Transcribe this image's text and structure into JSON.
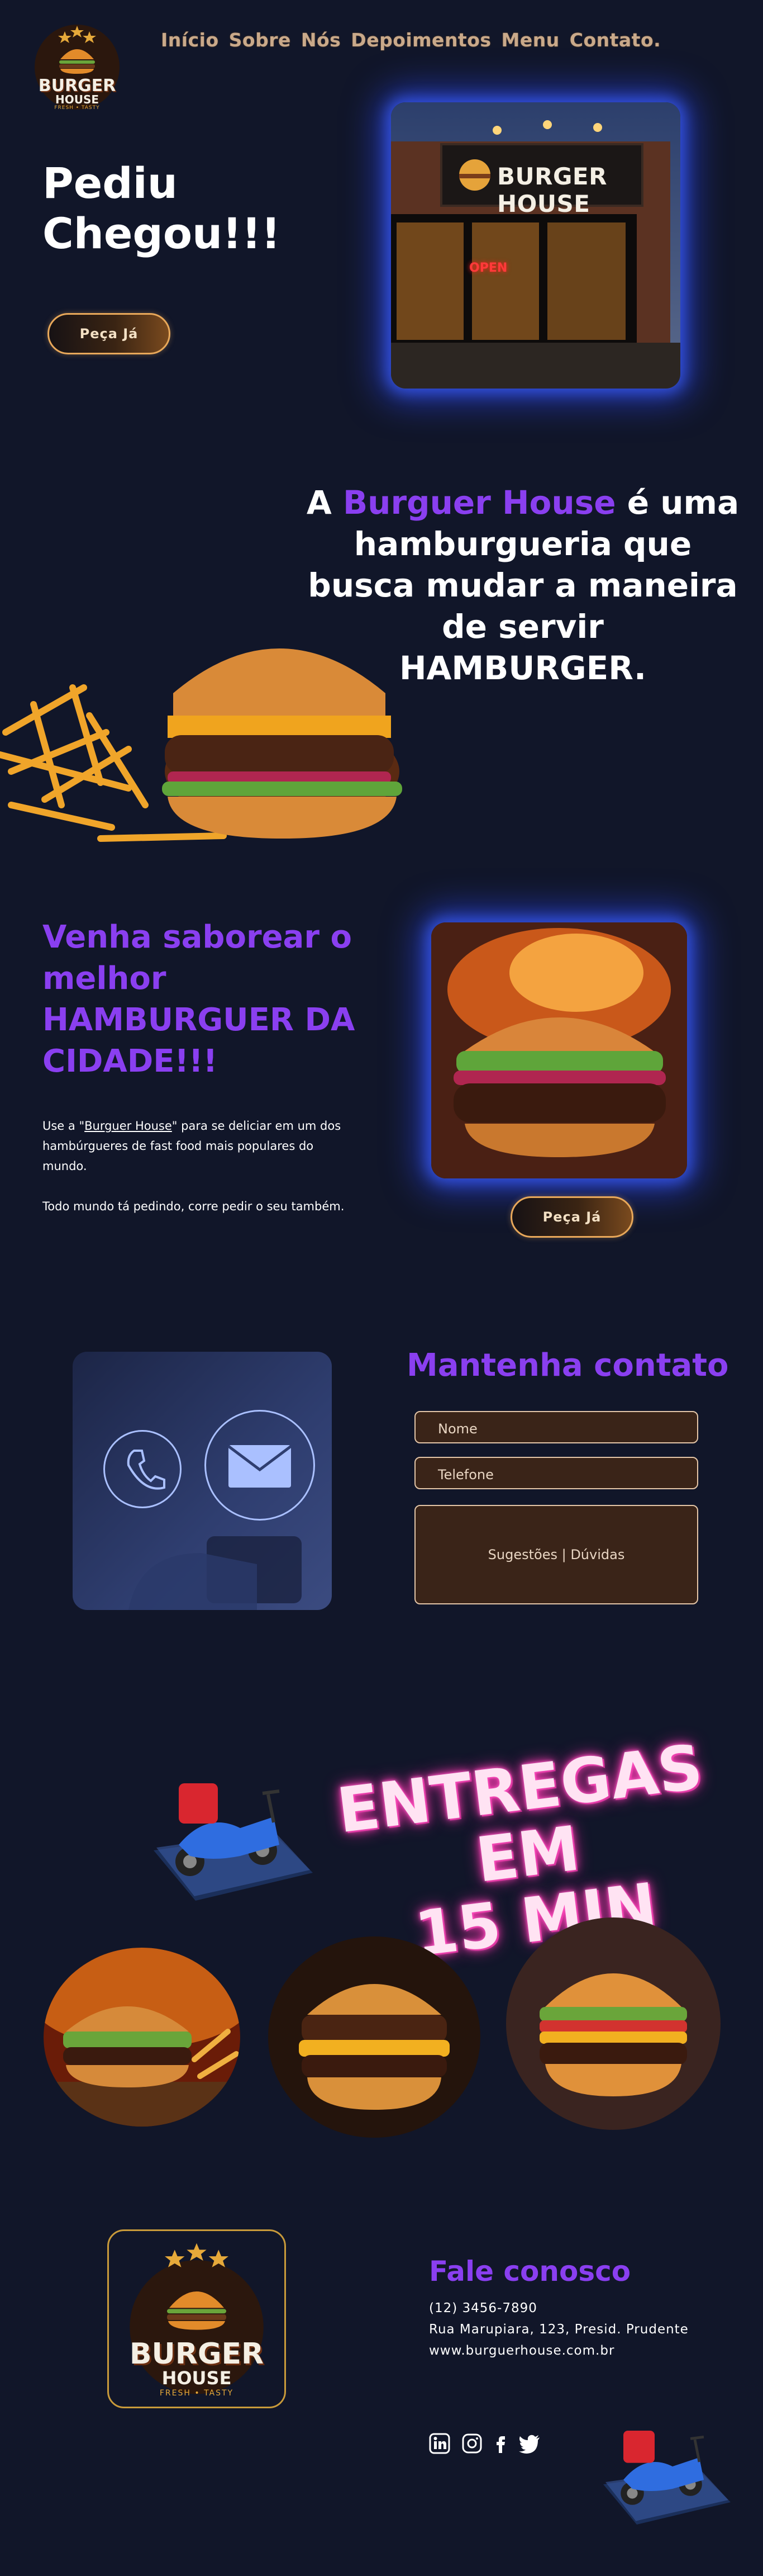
{
  "nav": {
    "items": [
      {
        "label": "Início"
      },
      {
        "label": "Sobre"
      },
      {
        "label": "Nós"
      },
      {
        "label": "Depoimentos"
      },
      {
        "label": "Menu"
      },
      {
        "label": "Contato."
      }
    ]
  },
  "logo": {
    "brand_top": "BURGER",
    "brand_bottom": "HOUSE",
    "tagline": "FRESH • TASTY"
  },
  "hero": {
    "title_line1": "Pediu",
    "title_line2": "Chegou!!!",
    "cta": "Peça Já",
    "storefront_sign": "BURGER HOUSE",
    "open_sign": "OPEN"
  },
  "about": {
    "prefix": "A ",
    "brand": "Burguer House",
    "suffix": " é uma hamburgueria que busca mudar a maneira de servir",
    "emphasis": "HAMBURGER."
  },
  "promo": {
    "title": "Venha saborear o melhor HAMBURGUER DA CIDADE!!!",
    "p1_before": "Use a \"",
    "p1_link": "Burguer House",
    "p1_after": "\" para se deliciar em um dos hambúrgueres de fast food mais populares do mundo.",
    "p2": "Todo mundo tá pedindo, corre pedir o seu também.",
    "cta": "Peça Já"
  },
  "contact": {
    "title": "Mantenha contato",
    "name_placeholder": "Nome",
    "phone_placeholder": "Telefone",
    "message_placeholder": "Sugestões | Dúvidas"
  },
  "delivery": {
    "line1": "ENTREGAS EM",
    "line2": "15 MIN"
  },
  "footer": {
    "title": "Fale conosco",
    "phone": "(12) 3456-7890",
    "address": "Rua Marupiara, 123, Presid. Prudente",
    "website": "www.burguerhouse.com.br",
    "social": [
      "linkedin-icon",
      "instagram-icon",
      "facebook-icon",
      "twitter-icon"
    ]
  },
  "colors": {
    "background": "#111629",
    "accent_purple": "#8a3ff0",
    "button_border": "#e8a85a",
    "glow_blue": "#2d4bff",
    "neon_pink": "#ff3fb5"
  }
}
